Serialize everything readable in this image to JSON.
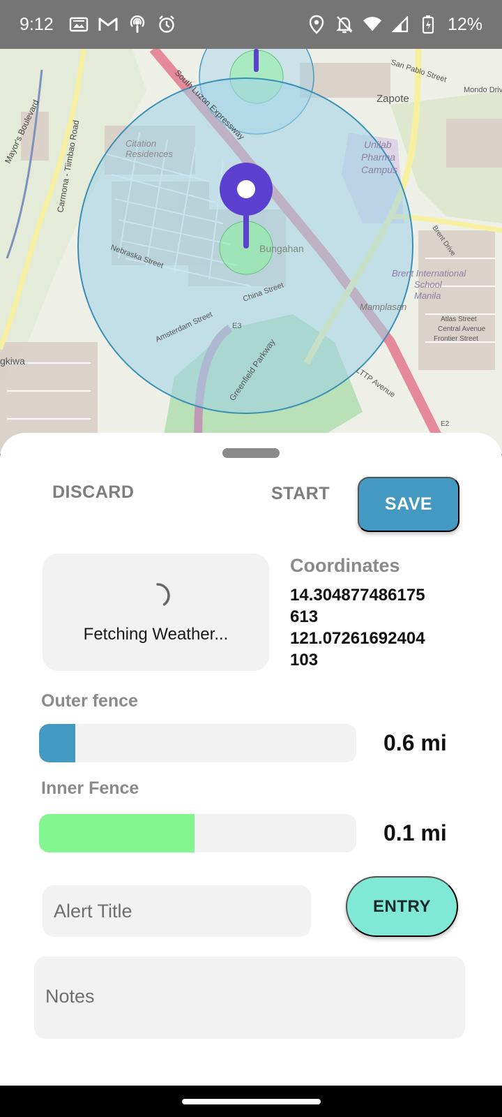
{
  "status_bar": {
    "time": "9:12",
    "left_icons": [
      "gallery-icon",
      "gmail-icon",
      "podcast-icon",
      "alarm-icon"
    ],
    "right_icons": [
      "location-icon",
      "mute-icon",
      "wifi-icon",
      "signal-icon",
      "battery-icon"
    ],
    "battery_percent": "12%"
  },
  "map": {
    "labels": {
      "zapote": "Zapote",
      "san_pablo": "San Pablo Street",
      "mondo": "Mondo Drive",
      "unilab": "Unilab",
      "pharma": "Pharma",
      "campus": "Campus",
      "citation1": "Citation",
      "citation2": "Residences",
      "bungahan": "Bungahan",
      "brent1": "Brent International",
      "brent2": "School",
      "brent3": "Manila",
      "mamplasan": "Mamplasan",
      "e3": "E3",
      "greenfield": "Greenfield Parkway",
      "gkiwa": "gkiwa",
      "slex": "South Luzon Expressway",
      "carmona": "Carmona - Tiimbao Road",
      "mayors": "Mayor's Boulevard",
      "china": "China Street",
      "amsterdam": "Amsterdam Street",
      "nebraska": "Nebraska Street",
      "lttp": "LTTP Avenue",
      "atlas": "Atlas Street",
      "central": "Central Avenue",
      "frontier": "Frontier Street",
      "e2": "E2",
      "brent_drive": "Brent Drive"
    },
    "colors": {
      "outer_circle": "#4399c1",
      "inner_circle": "#83f591",
      "pin": "#5b3fcf"
    }
  },
  "sheet": {
    "discard_label": "DISCARD",
    "start_label": "START",
    "save_label": "SAVE",
    "weather_text": "Fetching Weather...",
    "coords_title": "Coordinates",
    "coords_lat": "14.304877486175613",
    "coords_lng": "121.07261692404103",
    "outer_label": "Outer fence",
    "outer_value": "0.6 mi",
    "outer_fill_fraction": 0.115,
    "inner_label": "Inner Fence",
    "inner_value": "0.1 mi",
    "inner_fill_fraction": 0.49,
    "alert_placeholder": "Alert Title",
    "entry_label": "ENTRY",
    "notes_placeholder": "Notes"
  }
}
